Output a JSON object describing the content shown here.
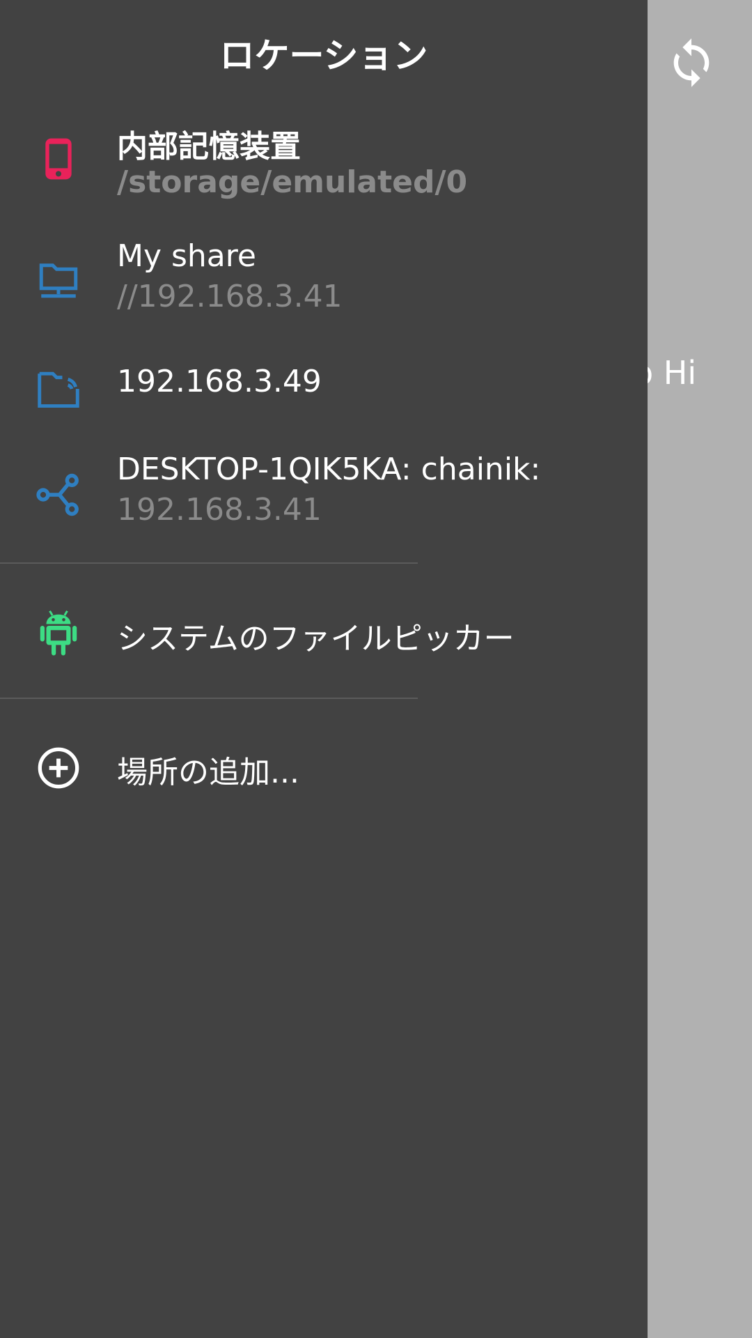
{
  "drawer": {
    "title": "ロケーション",
    "locations": [
      {
        "name": "内部記憶装置",
        "path": "/storage/emulated/0",
        "icon": "phone-icon",
        "color": "#e9225a"
      },
      {
        "name": "My share",
        "path": "//192.168.3.41",
        "icon": "computer-folder-icon",
        "color": "#2f7fc1"
      },
      {
        "name": "192.168.3.49",
        "icon": "network-folder-icon",
        "color": "#2f7fc1"
      },
      {
        "name": "DESKTOP-1QIK5KA: chainik:",
        "path": "192.168.3.41",
        "icon": "share-icon",
        "color": "#2f7fc1"
      }
    ],
    "system_picker": {
      "label": "システムのファイルピッカー",
      "icon": "android-icon",
      "color": "#3ddc84"
    },
    "add_location": {
      "label": "場所の追加...",
      "icon": "add-circle-icon"
    }
  },
  "background": {
    "partial_text": "o Hi",
    "refresh_icon": "refresh-icon"
  }
}
